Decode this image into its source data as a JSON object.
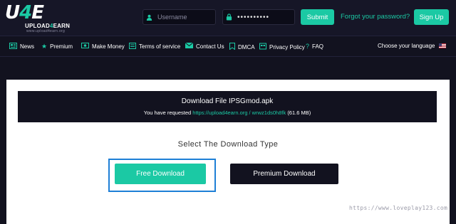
{
  "header": {
    "logo": {
      "mark_u": "U",
      "mark_four": "4",
      "mark_e": "E",
      "name_a": "UPLOAD",
      "name_b": "4",
      "name_c": "EARN",
      "sub": "www.upload4earn.org"
    },
    "username_placeholder": "Username",
    "password_value": "••••••••••",
    "submit_label": "Submit",
    "forgot_label": "Forgot your password?",
    "signup_label": "Sign Up",
    "accent_color": "#1bc9a4"
  },
  "nav": {
    "items": [
      {
        "label": "News",
        "icon": "newspaper-icon"
      },
      {
        "label": "Premium",
        "icon": "star-icon"
      },
      {
        "label": "Make Money",
        "icon": "money-icon"
      },
      {
        "label": "Terms of service",
        "icon": "document-icon"
      },
      {
        "label": "Contact Us",
        "icon": "envelope-icon"
      },
      {
        "label": "DMCA",
        "icon": "bookmark-icon"
      },
      {
        "label": "Privacy Policy",
        "icon": "shield-icon"
      },
      {
        "label": "FAQ",
        "icon": "question-icon"
      }
    ],
    "language_label": "Choose your language",
    "language_flag": "us-flag-icon"
  },
  "download": {
    "file_title": "Download File IPSGmod.apk",
    "requested_prefix": "You have requested",
    "requested_link": "https://upload4earn.org / wrwz1ds0h8fk",
    "requested_size": "(61.6 MB)",
    "select_title": "Select The Download Type",
    "free_label": "Free Download",
    "premium_label": "Premium Download"
  },
  "watermark": "https://www.loveplay123.com"
}
